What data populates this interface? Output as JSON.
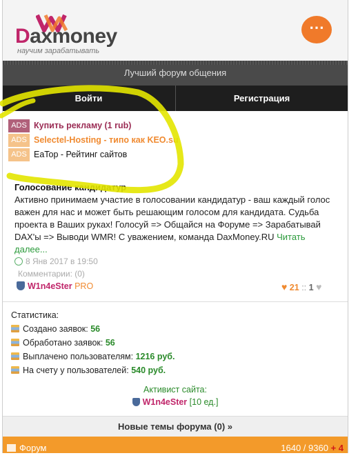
{
  "brand": {
    "name_d": "D",
    "name_rest": "axmoney",
    "tagline": "научим зарабатывать",
    "menu_icon": "⋯",
    "colors": {
      "brand": "#c0266a",
      "accent": "#f07a2a",
      "green": "#2a8a2a"
    }
  },
  "header": {
    "subtitle": "Лучший форум общения"
  },
  "auth": {
    "login": "Войти",
    "register": "Регистрация"
  },
  "ads": [
    {
      "badge": "ADS",
      "text": "Купить рекламу (1 rub)"
    },
    {
      "badge": "ADS",
      "text": "Selectel-Hosting - типо как KEO.su"
    },
    {
      "badge": "ADS",
      "text": "EaTop - Рейтинг сайтов"
    }
  ],
  "post": {
    "title": "Голосование кандидатур",
    "body": "Активно принимаем участие в голосовании кандидатур - ваш каждый голос важен для нас и может быть решающим голосом для кандидата. Судьба проекта в Ваших руках! Голосуй => Общайся на Форуме => Зарабатывай DAX'ы => Выводи WMR! С уважением, команда DaxMoney.RU",
    "read_more": "Читать далее...",
    "date": "8 Янв 2017 в 19:50",
    "comments": "Комментарии: (0)",
    "author": "W1n4eSter",
    "author_tag": "PRO",
    "likes": "21",
    "separator": "::",
    "dislikes": "1"
  },
  "stats": {
    "title": "Статистика:",
    "rows": [
      {
        "label": "Создано заявок:",
        "value": "56"
      },
      {
        "label": "Обработано заявок:",
        "value": "56"
      },
      {
        "label": "Выплачено пользователям:",
        "value": "1216 руб."
      },
      {
        "label": "На счету у пользователей:",
        "value": "540 руб."
      }
    ]
  },
  "activist": {
    "label": "Активист сайта:",
    "name": "W1n4eSter",
    "count": "[10 ед.]"
  },
  "new_topics": "Новые темы форума (0) »",
  "forum_bar": {
    "label": "Форум",
    "counts": "1640 / 9360",
    "plus": "+ 4"
  }
}
